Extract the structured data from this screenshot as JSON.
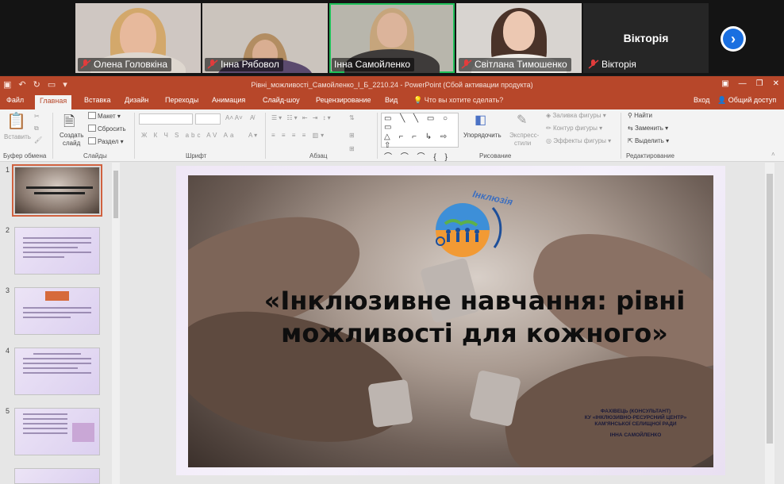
{
  "participants": [
    {
      "name": "Олена Головкіна",
      "muted": true
    },
    {
      "name": "Інна Рябовол",
      "muted": true
    },
    {
      "name": "Інна Самойленко",
      "muted": false,
      "active": true
    },
    {
      "name": "Світлана Тимошенко",
      "muted": true
    },
    {
      "name": "Вікторія",
      "muted": true,
      "video_off": true,
      "display_name": "Вікторія"
    }
  ],
  "window": {
    "title": "Рівні_можливості_Самойленко_І_Б_2210.24 - PowerPoint (Сбой активации продукта)"
  },
  "tabs": [
    "Файл",
    "Главная",
    "Вставка",
    "Дизайн",
    "Переходы",
    "Анимация",
    "Слайд-шоу",
    "Рецензирование",
    "Вид"
  ],
  "tell_me": "Что вы хотите сделать?",
  "signin": "Вход",
  "share": "Общий доступ",
  "ribbon": {
    "clipboard": {
      "paste": "Вставить",
      "label": "Буфер обмена"
    },
    "slides": {
      "new_slide_1": "Создать",
      "new_slide_2": "слайд",
      "layout": "Макет",
      "reset": "Сбросить",
      "section": "Раздел",
      "label": "Слайды"
    },
    "font": {
      "label": "Шрифт",
      "buttons": "Ж  К  Ч  S  abc  AV  Аа"
    },
    "paragraph": {
      "label": "Абзац"
    },
    "drawing": {
      "arrange": "Упорядочить",
      "quick_styles_1": "Экспресс-",
      "quick_styles_2": "стили",
      "fill": "Заливка фигуры",
      "outline": "Контур фигуры",
      "effects": "Эффекты фигуры",
      "label": "Рисование"
    },
    "editing": {
      "find": "Найти",
      "replace": "Заменить",
      "select": "Выделить",
      "label": "Редактирование"
    }
  },
  "thumbnails": [
    "1",
    "2",
    "3",
    "4",
    "5"
  ],
  "slide": {
    "logo_text": "Інклюзія",
    "title_line1": "«Інклюзивне навчання: рівні",
    "title_line2": "можливості для кожного»",
    "caption_line1": "ФАХІВЕЦЬ (КОНСУЛЬТАНТ)",
    "caption_line2": "КУ «ІНКЛЮЗИВНО-РЕСУРСНИЙ ЦЕНТР»",
    "caption_line3": "КАМ'ЯНСЬКОЇ СЕЛИЩНОЇ РАДИ",
    "caption_line4": "ІННА САМОЙЛЕНКО"
  },
  "colors": {
    "ppt_accent": "#b7472a",
    "active_speaker": "#1fc05a",
    "next_button": "#1a6fe0"
  }
}
